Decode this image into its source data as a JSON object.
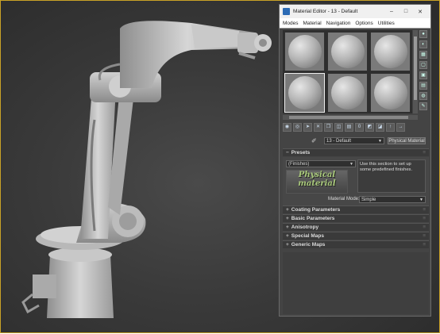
{
  "window": {
    "title": "Material Editor - 13 - Default",
    "minimize": "–",
    "maximize": "□",
    "close": "✕"
  },
  "menu": [
    "Modes",
    "Material",
    "Navigation",
    "Options",
    "Utilities"
  ],
  "icons": {
    "app": "material-editor-icon",
    "picker": "eyedropper-icon"
  },
  "material": {
    "name": "13 - Default",
    "type": "Physical Material"
  },
  "presets": {
    "header": "Presets",
    "finishes": "(Finishes)",
    "logo_line1": "Physical",
    "logo_line2": "material",
    "hint": "Use this section to set up some predefined finishes.",
    "mode_label": "Material Mode:",
    "mode_value": "Simple"
  },
  "rollouts": [
    "Coating Parameters",
    "Basic Parameters",
    "Anisotropy",
    "Special Maps",
    "Generic Maps"
  ],
  "colors": {
    "viewport_border": "#c9a227",
    "sample_active": "#eeeeee"
  }
}
